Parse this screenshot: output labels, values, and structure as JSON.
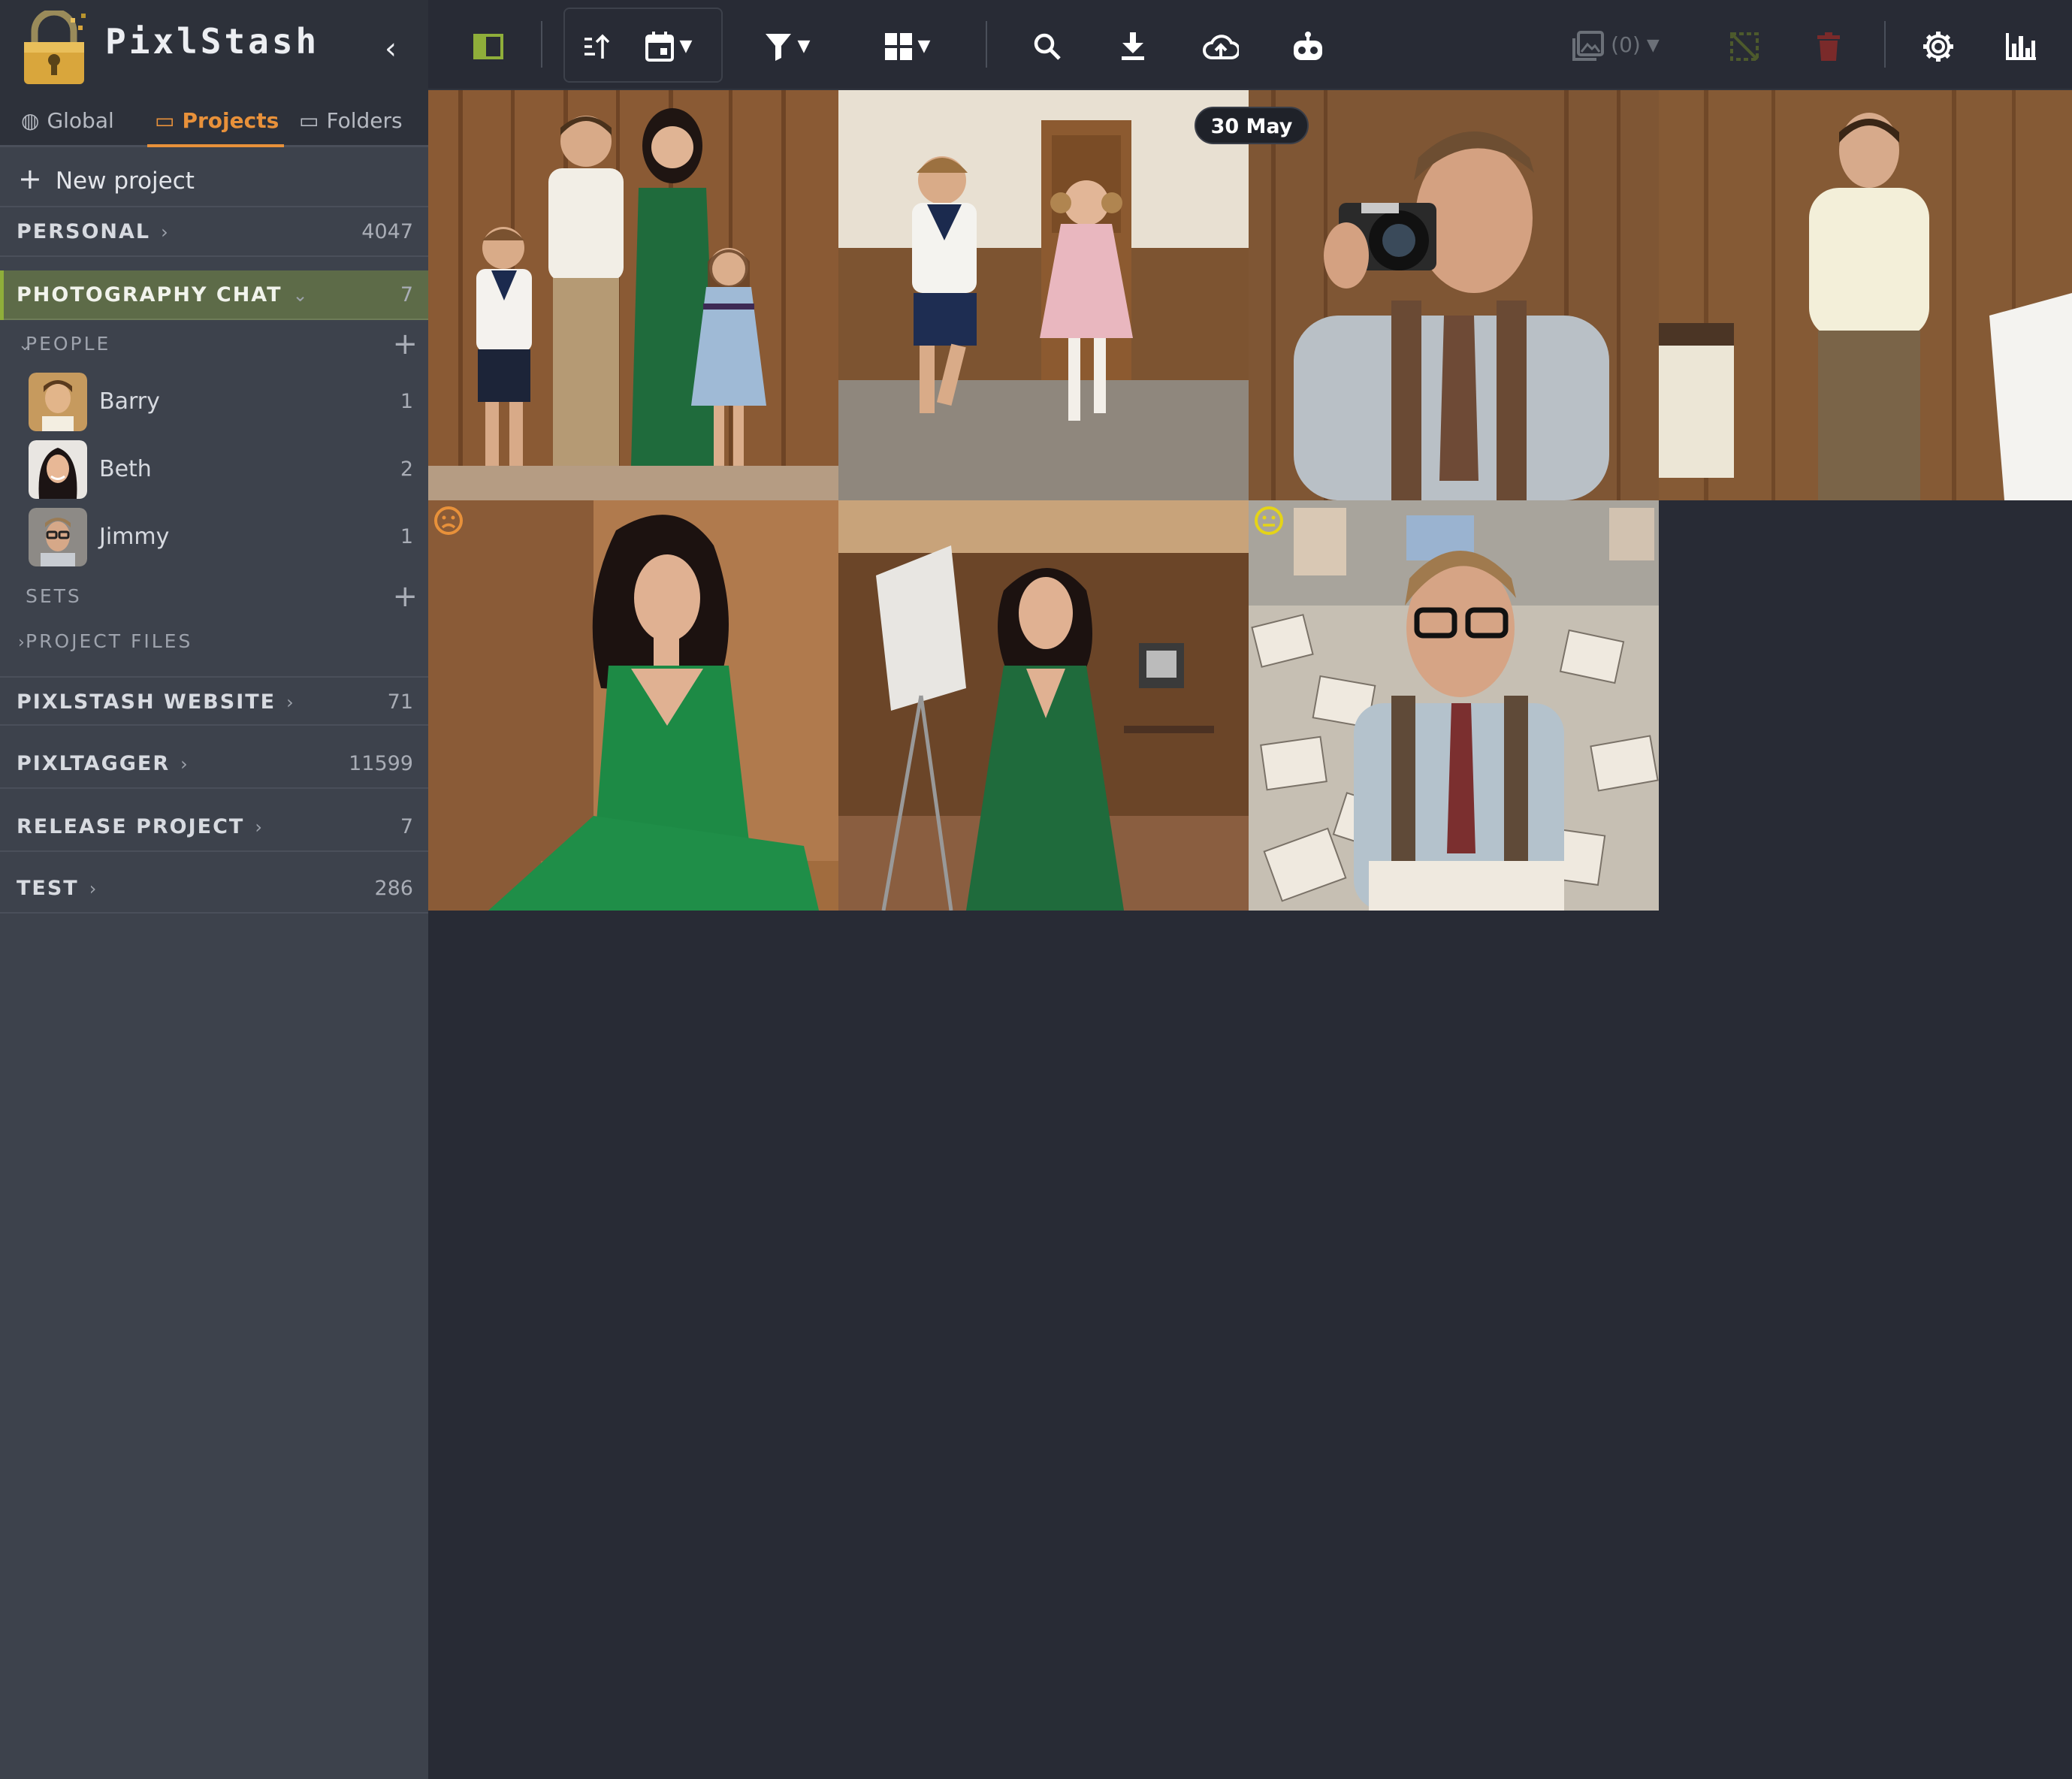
{
  "app": {
    "name": "PixlStash",
    "collapse_icon": "chevron-left-icon"
  },
  "tabs": [
    {
      "label": "Global",
      "icon": "globe-icon",
      "active": false
    },
    {
      "label": "Projects",
      "icon": "folder-icon",
      "active": true
    },
    {
      "label": "Folders",
      "icon": "monitor-icon",
      "active": false
    }
  ],
  "new_project": {
    "label": "New project",
    "icon": "plus-icon"
  },
  "projects": [
    {
      "name": "PERSONAL",
      "count": "4047"
    },
    {
      "name": "PHOTOGRAPHY CHAT",
      "count": "7",
      "active": true
    },
    {
      "name": "PIXLSTASH WEBSITE",
      "count": "71"
    },
    {
      "name": "PIXLTAGGER",
      "count": "11599"
    },
    {
      "name": "RELEASE PROJECT",
      "count": "7"
    },
    {
      "name": "TEST",
      "count": "286"
    }
  ],
  "sections": {
    "people": "PEOPLE",
    "sets": "SETS",
    "project_files": "PROJECT FILES"
  },
  "people": [
    {
      "name": "Barry",
      "count": "1"
    },
    {
      "name": "Beth",
      "count": "2"
    },
    {
      "name": "Jimmy",
      "count": "1"
    }
  ],
  "toolbar": {
    "sidebar_toggle_icon": "sidebar-toggle-icon",
    "sort_icon": "sort-order-icon",
    "date_icon": "calendar-icon",
    "filter_icon": "filter-icon",
    "grid_icon": "grid-view-icon",
    "search_icon": "search-icon",
    "download_icon": "download-icon",
    "upload_icon": "cloud-upload-icon",
    "ai_icon": "robot-icon",
    "selection_count": "(0)",
    "settings_icon": "gear-icon",
    "stats_icon": "bar-chart-icon"
  },
  "gallery": {
    "date_label": "30 May",
    "images": [
      {
        "subject": "family-portrait"
      },
      {
        "subject": "children-running"
      },
      {
        "subject": "man-with-camera"
      },
      {
        "subject": "man-standing"
      },
      {
        "subject": "woman-green-dress-sitting",
        "reaction": "sad"
      },
      {
        "subject": "woman-green-dress-studio"
      },
      {
        "subject": "man-with-photos",
        "reaction": "neutral"
      }
    ]
  },
  "colors": {
    "accent": "#e8913a",
    "active_project": "#5d6b48",
    "sidebar_bg": "#3d424c",
    "main_bg": "#282b35",
    "toolbar_green": "#8fae3a",
    "delete_red": "#7a2a2a"
  }
}
